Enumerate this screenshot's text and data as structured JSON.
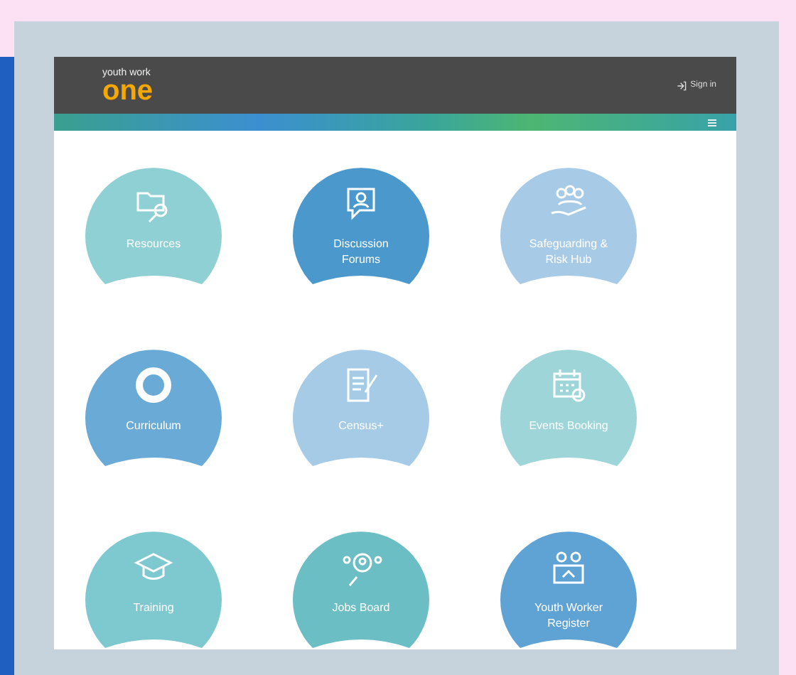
{
  "header": {
    "logo": {
      "top": "youth work",
      "main": "one"
    },
    "sign_in": "Sign in"
  },
  "tiles": [
    {
      "label": "Resources",
      "color": "#8ed0d3"
    },
    {
      "label": "Discussion Forums",
      "color": "#4b98cc"
    },
    {
      "label": "Safeguarding & Risk Hub",
      "color": "#a7cbe7"
    },
    {
      "label": "Curriculum",
      "color": "#6aaad6"
    },
    {
      "label": "Census+",
      "color": "#a6cbe6"
    },
    {
      "label": "Events Booking",
      "color": "#9dd5d8"
    },
    {
      "label": "Training",
      "color": "#7ec9cf"
    },
    {
      "label": "Jobs Board",
      "color": "#6bbec4"
    },
    {
      "label": "Youth Worker Register",
      "color": "#5fa3d5"
    }
  ]
}
